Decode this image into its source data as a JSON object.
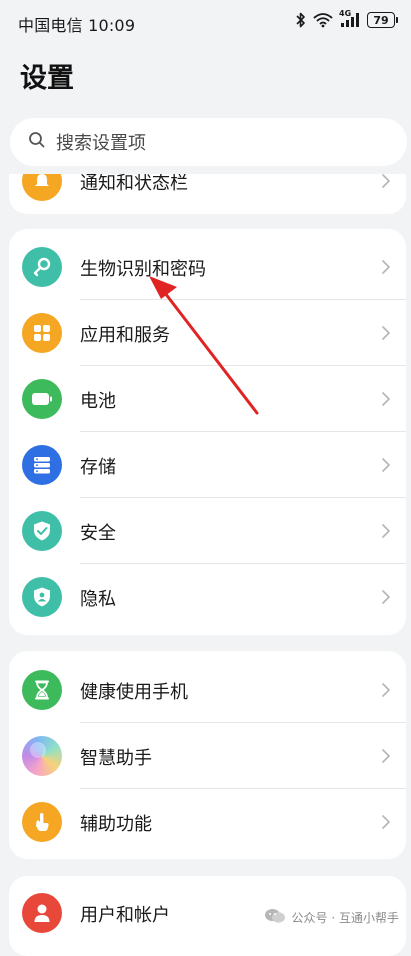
{
  "status_bar": {
    "carrier_time": "中国电信 10:09",
    "network": "4G",
    "battery": "79"
  },
  "title": "设置",
  "search": {
    "placeholder": "搜索设置项"
  },
  "groups": [
    {
      "items": [
        {
          "label": "通知和状态栏",
          "icon": "bell-icon",
          "color": "#f5a623"
        }
      ]
    },
    {
      "items": [
        {
          "label": "生物识别和密码",
          "icon": "key-icon",
          "color": "#3fbfa7"
        },
        {
          "label": "应用和服务",
          "icon": "apps-icon",
          "color": "#f5a623"
        },
        {
          "label": "电池",
          "icon": "battery-icon",
          "color": "#3dbb5c"
        },
        {
          "label": "存储",
          "icon": "storage-icon",
          "color": "#2f6fe4"
        },
        {
          "label": "安全",
          "icon": "shield-check-icon",
          "color": "#3fbfa7"
        },
        {
          "label": "隐私",
          "icon": "privacy-icon",
          "color": "#3fbfa7"
        }
      ]
    },
    {
      "items": [
        {
          "label": "健康使用手机",
          "icon": "hourglass-icon",
          "color": "#3dbb5c"
        },
        {
          "label": "智慧助手",
          "icon": "assistant-orb-icon",
          "color": "#c08ae8"
        },
        {
          "label": "辅助功能",
          "icon": "hand-icon",
          "color": "#f5a623"
        }
      ]
    },
    {
      "items": [
        {
          "label": "用户和帐户",
          "icon": "user-icon",
          "color": "#e8483a"
        }
      ]
    }
  ],
  "watermark": "公众号 · 互通小帮手",
  "annotation_color": "#e02424"
}
